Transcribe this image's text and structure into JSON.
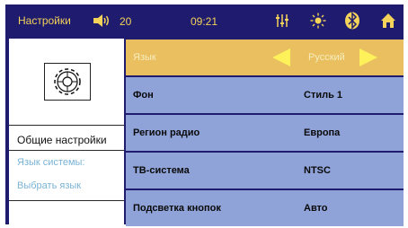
{
  "header": {
    "title": "Настройки",
    "volume": "20",
    "time": "09:21"
  },
  "left_panel": {
    "active_label": "Общие настройки",
    "sub_items": [
      "Язык системы:",
      "Выбрать язык"
    ]
  },
  "settings": {
    "rows": [
      {
        "label": "Язык",
        "value": "Русский"
      },
      {
        "label": "Фон",
        "value": "Стиль 1"
      },
      {
        "label": "Регион радио",
        "value": "Европа"
      },
      {
        "label": "ТВ-система",
        "value": "NTSC"
      },
      {
        "label": "Подсветка кнопок",
        "value": "Авто"
      }
    ]
  },
  "colors": {
    "accent": "#f3d35a",
    "row_bg": "#8fa3d9",
    "selected_bg": "#e9bf5f",
    "frame": "#1f1b6e"
  },
  "icons": [
    "speaker-icon",
    "equalizer-icon",
    "brightness-icon",
    "bluetooth-icon",
    "home-icon",
    "gear-icon",
    "arrow-left-icon",
    "arrow-right-icon"
  ]
}
